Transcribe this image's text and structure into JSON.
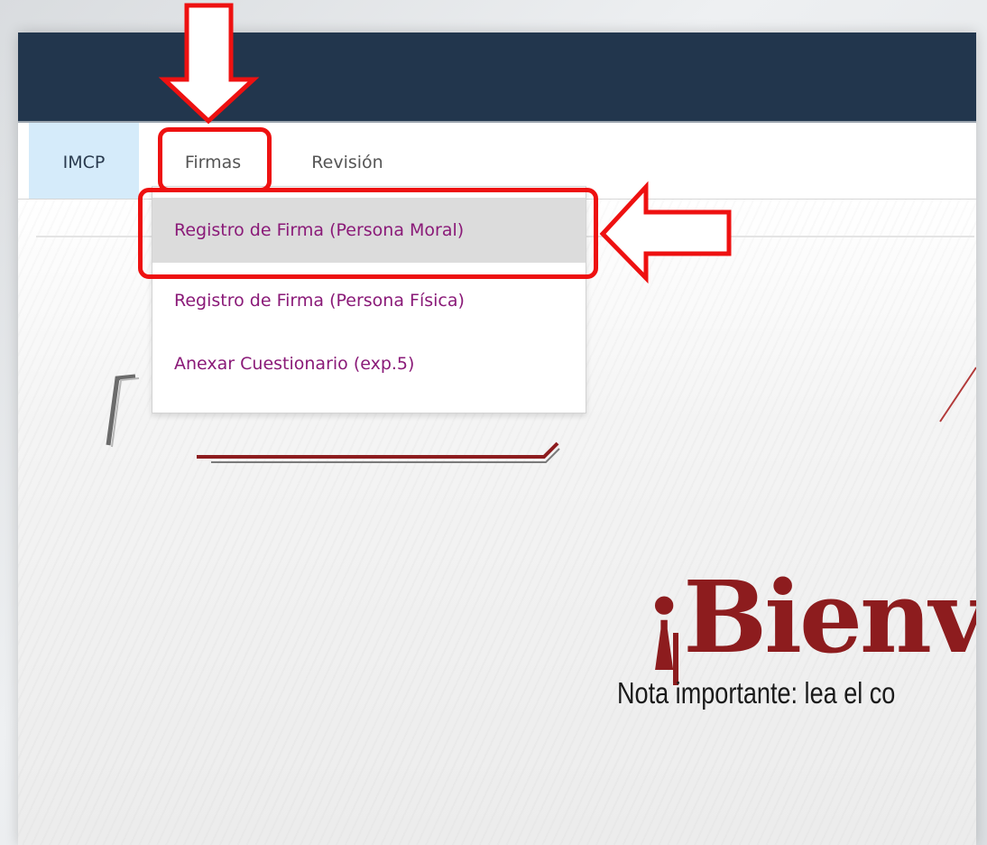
{
  "nav": {
    "items": [
      {
        "label": "IMCP"
      },
      {
        "label": "Firmas"
      },
      {
        "label": "Revisión"
      }
    ]
  },
  "dropdown": {
    "items": [
      {
        "label": "Registro de Firma (Persona Moral)"
      },
      {
        "label": "Registro de Firma (Persona Física)"
      },
      {
        "label": "Anexar Cuestionario (exp.5)"
      }
    ]
  },
  "content": {
    "welcome": "¡Bienv",
    "note": "Nota importante: lea el co"
  },
  "colors": {
    "header": "#22364d",
    "active_tab": "#d5ebfa",
    "menu_text": "#8a1a78",
    "highlight": "#ee1111",
    "welcome": "#8d1c1e"
  },
  "annotations": {
    "arrows": [
      "arrow-down-icon",
      "arrow-left-icon"
    ]
  }
}
